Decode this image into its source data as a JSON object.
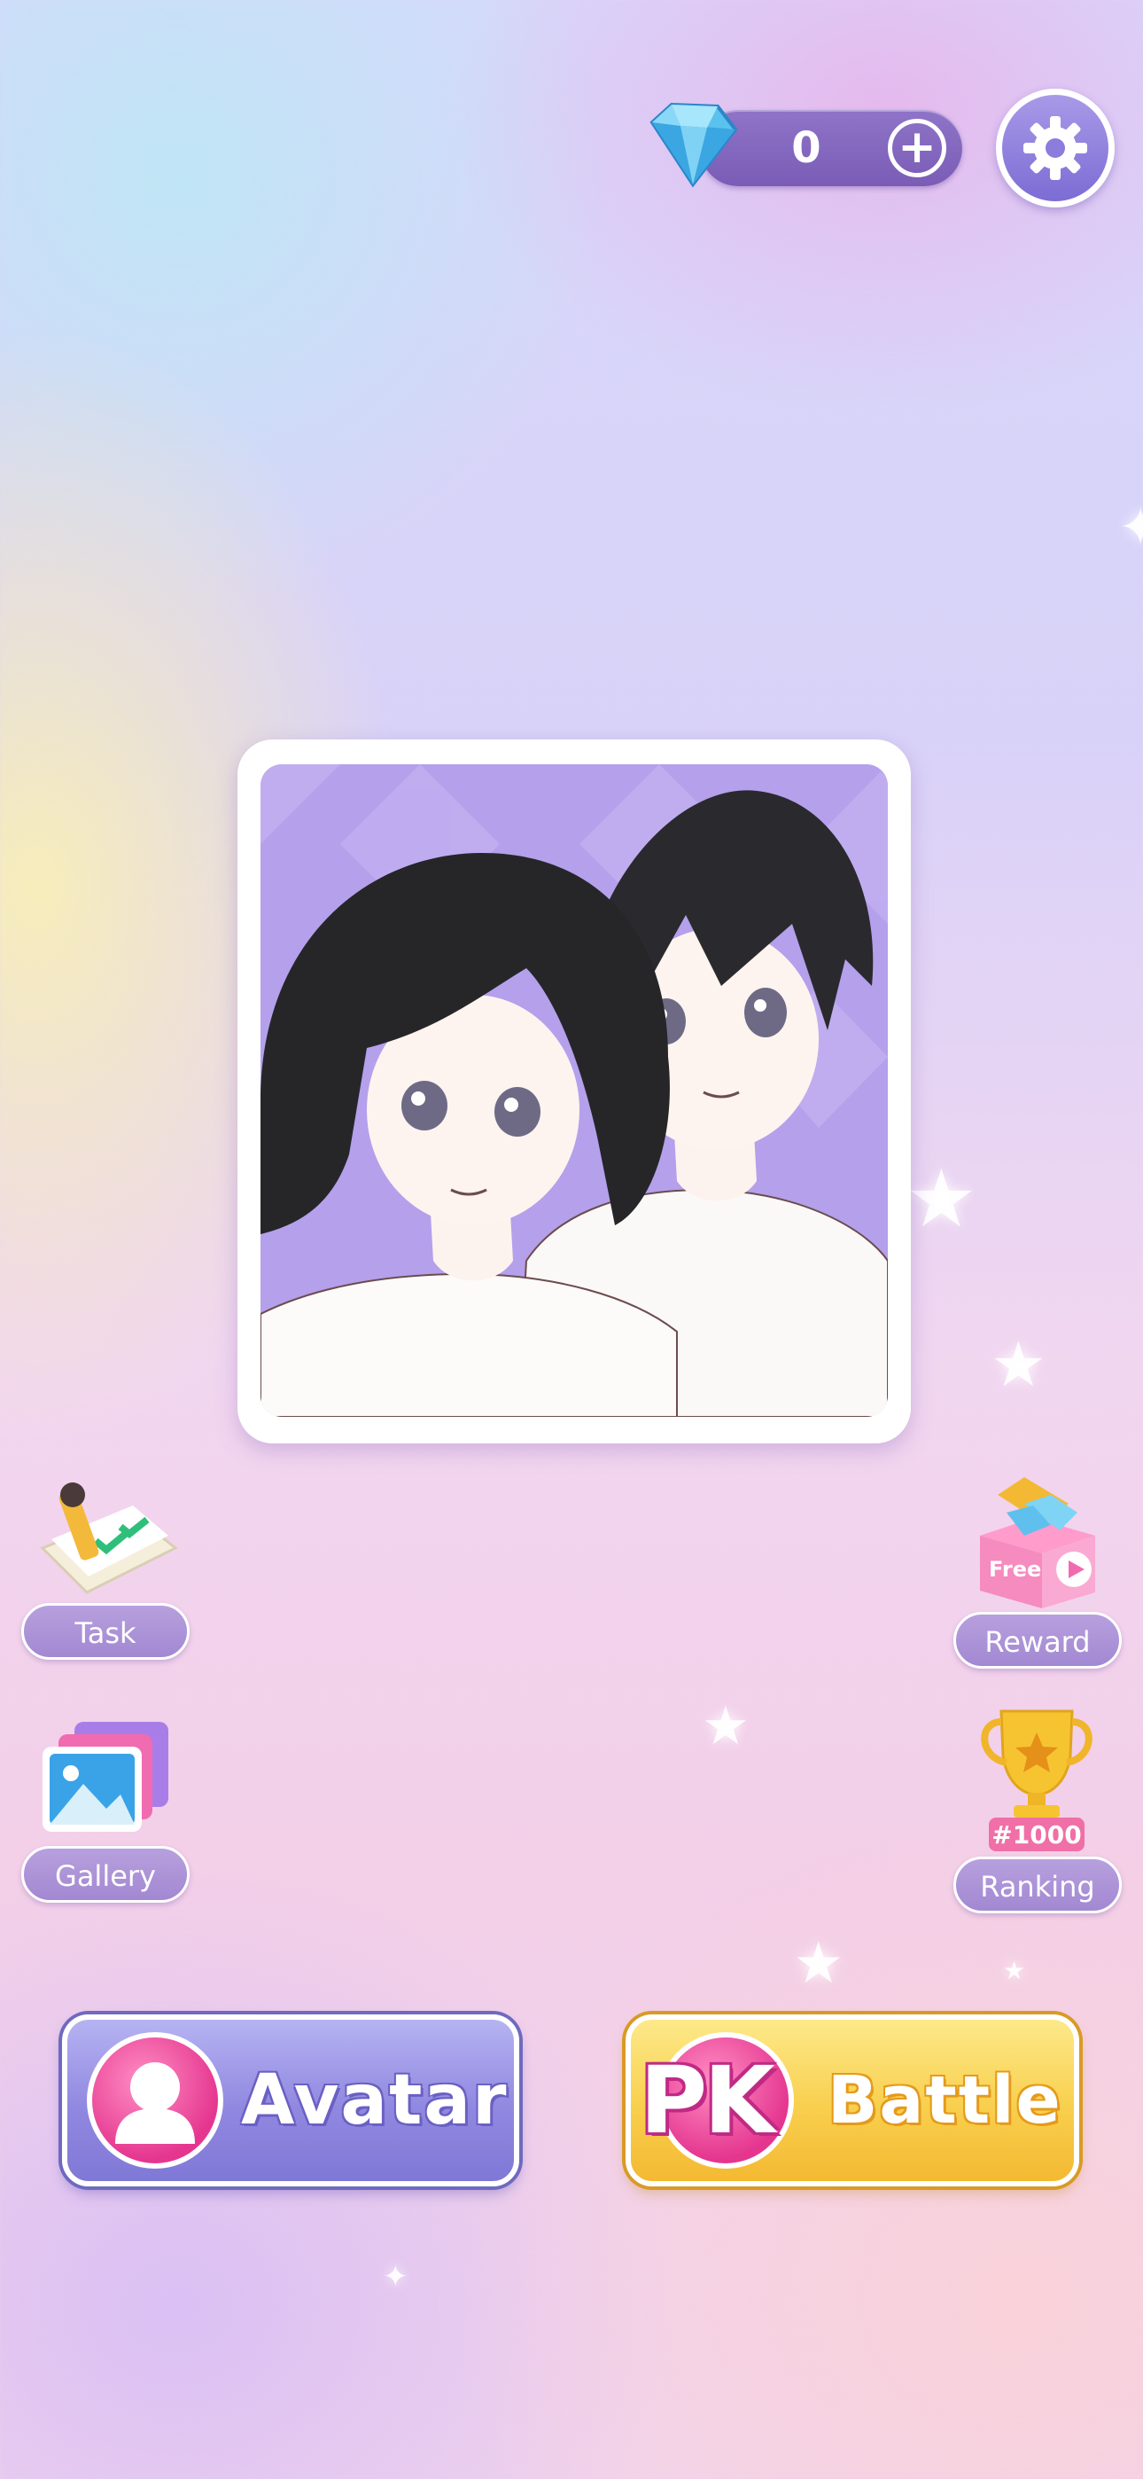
{
  "currency": {
    "gem_icon": "diamond-icon",
    "count": "0",
    "add_icon": "plus-icon"
  },
  "settings": {
    "icon": "gear-icon"
  },
  "portrait": {
    "description_icon": "couple-portrait"
  },
  "side_menu": {
    "task": {
      "label": "Task",
      "icon": "task-checklist-icon"
    },
    "gallery": {
      "label": "Gallery",
      "icon": "gallery-image-icon"
    },
    "reward": {
      "label": "Reward",
      "icon": "gift-box-icon",
      "badge": "Free"
    },
    "ranking": {
      "label": "Ranking",
      "icon": "trophy-icon",
      "rank": "#1000"
    }
  },
  "buttons": {
    "avatar": {
      "label": "Avatar",
      "icon": "person-silhouette-icon"
    },
    "battle": {
      "prefix": "PK",
      "label": "Battle"
    }
  },
  "colors": {
    "avatar_button": "#9088e0",
    "battle_button": "#f8cf4d",
    "accent_pink": "#e5368f",
    "pill_purple": "#a288d2"
  }
}
